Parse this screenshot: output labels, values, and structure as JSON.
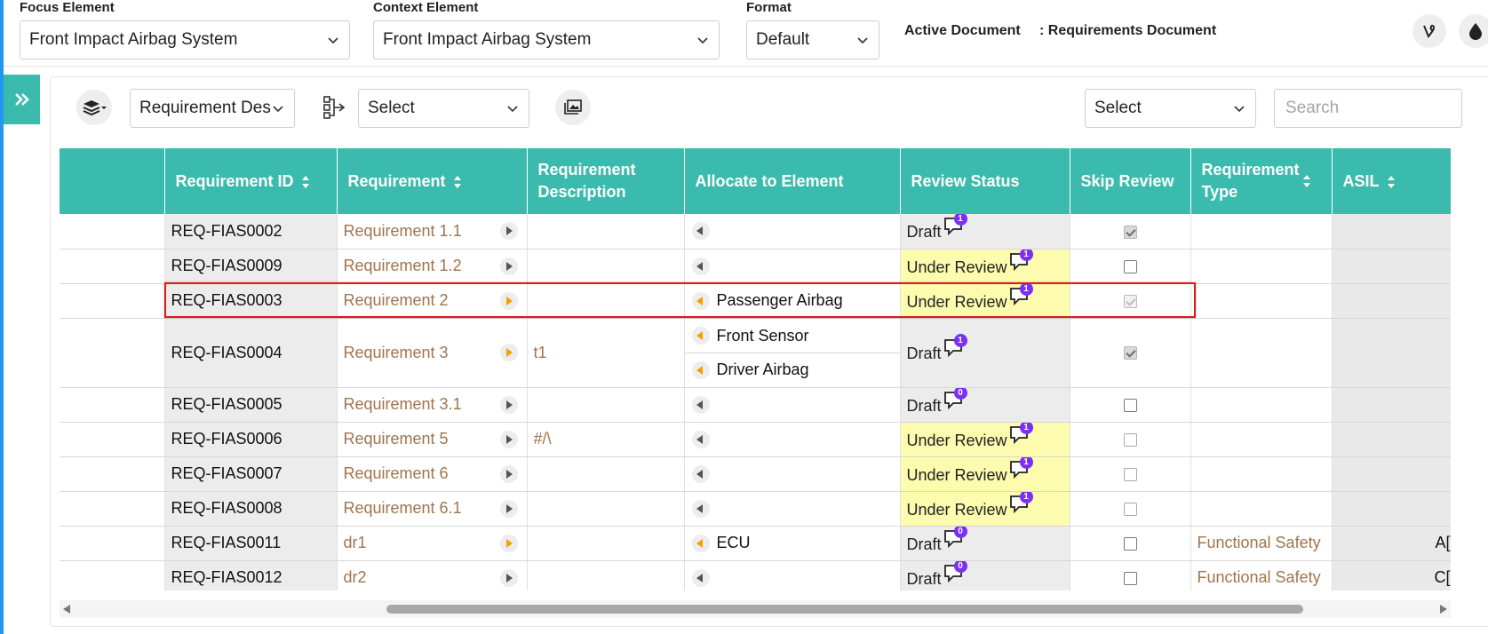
{
  "header": {
    "focus_label": "Focus Element",
    "focus_value": "Front Impact Airbag System",
    "context_label": "Context Element",
    "context_value": "Front Impact Airbag System",
    "format_label": "Format",
    "format_value": "Default",
    "active_doc_label": "Active Document",
    "active_doc_value": ": Requirements Document",
    "icons": [
      "vine-icon",
      "drop-icon",
      "more-icon"
    ]
  },
  "toolbar": {
    "layer_select": "Requirement Desc",
    "hierarchy_select": "Select",
    "filter_select": "Select",
    "search_placeholder": "Search"
  },
  "table": {
    "columns": [
      "",
      "Requirement ID",
      "Requirement",
      "Requirement Description",
      "Allocate to Element",
      "Review Status",
      "Skip Review",
      "Requirement Type",
      "ASIL"
    ],
    "rows": [
      {
        "id": "REQ-FIAS0002",
        "req": "Requirement 1.1",
        "desc": "",
        "alloc": [
          ""
        ],
        "status": "Draft",
        "count": "1",
        "skip": "checked",
        "type": "",
        "asil": ""
      },
      {
        "id": "REQ-FIAS0009",
        "req": "Requirement 1.2",
        "desc": "",
        "alloc": [
          ""
        ],
        "status": "Under Review",
        "count": "1",
        "skip": "empty",
        "type": "",
        "asil": ""
      },
      {
        "id": "REQ-FIAS0003",
        "req": "Requirement 2",
        "desc": "",
        "alloc": [
          "Passenger Airbag"
        ],
        "status": "Under Review",
        "count": "1",
        "skip": "faded",
        "type": "",
        "asil": ""
      },
      {
        "id": "REQ-FIAS0004",
        "req": "Requirement 3",
        "desc": "t1",
        "alloc": [
          "Front Sensor",
          "Driver Airbag"
        ],
        "status": "Draft",
        "count": "1",
        "skip": "checked",
        "type": "",
        "asil": ""
      },
      {
        "id": "REQ-FIAS0005",
        "req": "Requirement 3.1",
        "desc": "",
        "alloc": [
          ""
        ],
        "status": "Draft",
        "count": "0",
        "skip": "empty",
        "type": "",
        "asil": ""
      },
      {
        "id": "REQ-FIAS0006",
        "req": "Requirement 5",
        "desc": "#/\\",
        "alloc": [
          ""
        ],
        "status": "Under Review",
        "count": "1",
        "skip": "dim",
        "type": "",
        "asil": ""
      },
      {
        "id": "REQ-FIAS0007",
        "req": "Requirement 6",
        "desc": "",
        "alloc": [
          ""
        ],
        "status": "Under Review",
        "count": "1",
        "skip": "dim",
        "type": "",
        "asil": ""
      },
      {
        "id": "REQ-FIAS0008",
        "req": "Requirement 6.1",
        "desc": "",
        "alloc": [
          ""
        ],
        "status": "Under Review",
        "count": "1",
        "skip": "dim",
        "type": "",
        "asil": ""
      },
      {
        "id": "REQ-FIAS0011",
        "req": "dr1",
        "desc": "",
        "alloc": [
          "ECU"
        ],
        "status": "Draft",
        "count": "0",
        "skip": "empty",
        "type": "Functional Safety",
        "asil": "A[D]"
      },
      {
        "id": "REQ-FIAS0012",
        "req": "dr2",
        "desc": "",
        "alloc": [
          ""
        ],
        "status": "Draft",
        "count": "0",
        "skip": "empty",
        "type": "Functional Safety",
        "asil": "C[D]"
      }
    ]
  },
  "colors": {
    "header_teal": "#3bbbad",
    "under_review_bg": "#fcfbae",
    "badge_purple": "#7b2ff7",
    "link_brown": "#a0744c",
    "highlight_red": "#e0181b"
  }
}
